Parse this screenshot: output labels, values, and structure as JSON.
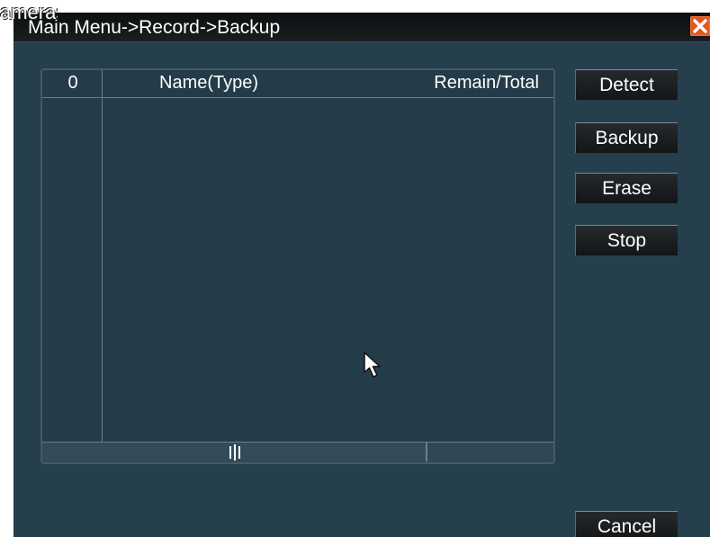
{
  "watermark": {
    "text": "ameras"
  },
  "window": {
    "title": "Main Menu->Record->Backup",
    "close_icon": "close-x-icon"
  },
  "device_list": {
    "columns": {
      "check": "0",
      "name": "Name(Type)",
      "remain_total": "Remain/Total"
    },
    "rows": []
  },
  "buttons": {
    "detect": "Detect",
    "backup": "Backup",
    "erase": "Erase",
    "stop": "Stop",
    "cancel": "Cancel"
  },
  "colors": {
    "window_bg": "#263f4d",
    "title_bar": "#111416",
    "close_button": "#e2561b",
    "button_bg": "#1d2023",
    "text": "#ffffff"
  }
}
